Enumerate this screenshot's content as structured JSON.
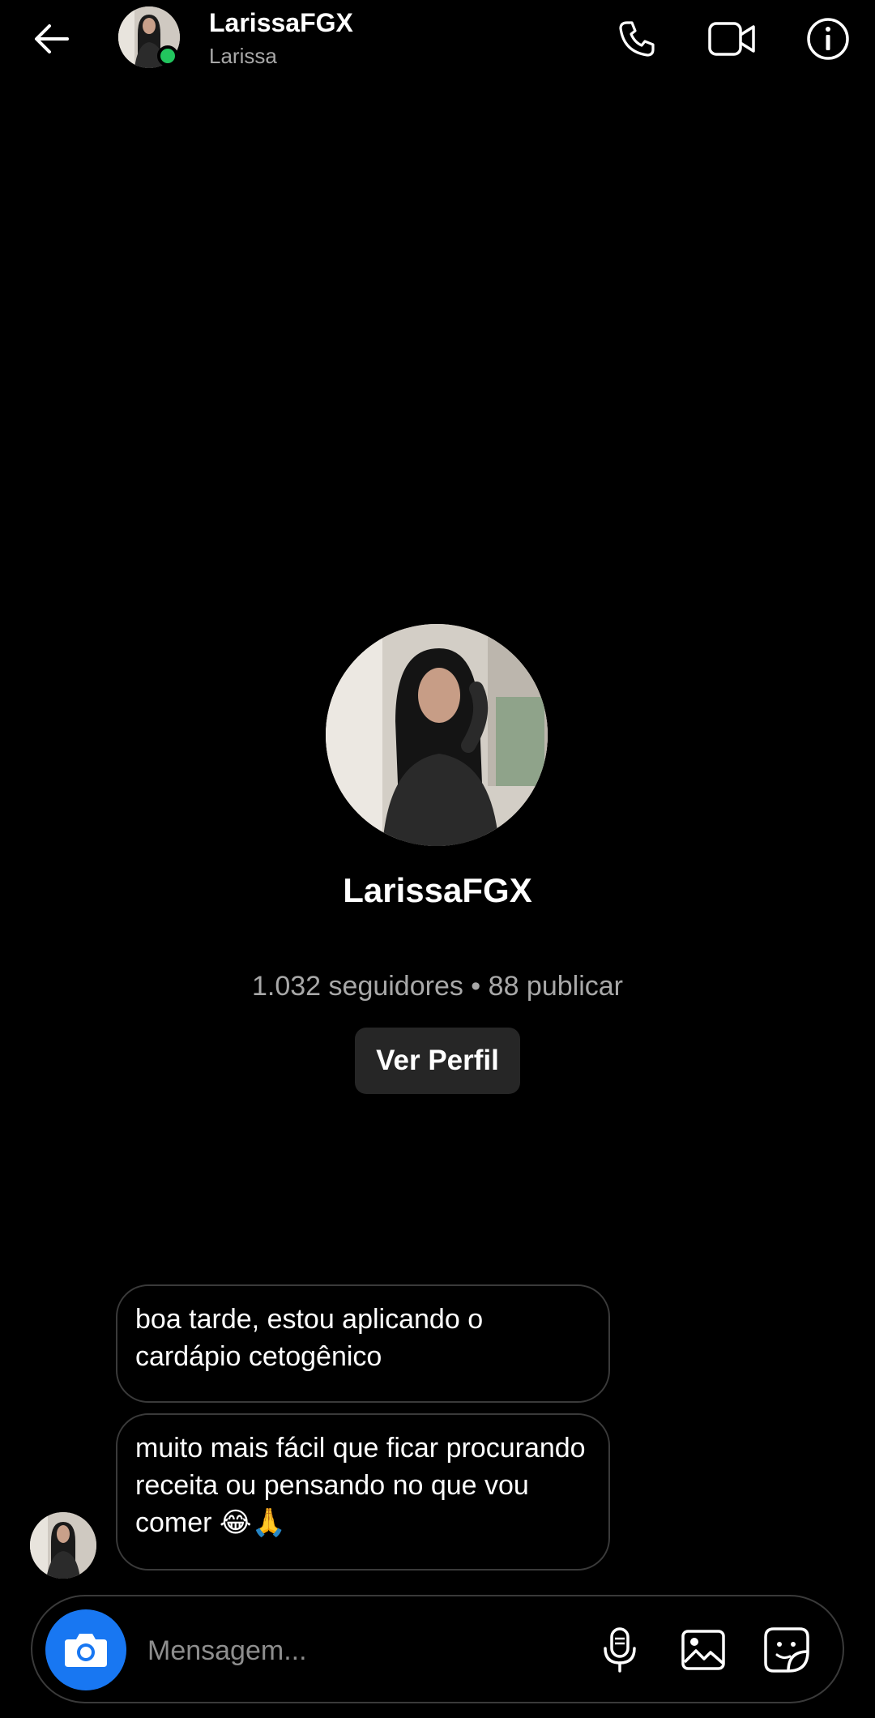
{
  "header": {
    "title": "LarissaFGX",
    "subtitle": "Larissa",
    "icons": [
      "back-arrow-icon",
      "phone-icon",
      "video-camera-icon",
      "info-icon"
    ]
  },
  "profile": {
    "name": "LarissaFGX",
    "stats": "1.032 seguidores • 88 publicar",
    "view_button": "Ver Perfil"
  },
  "messages": [
    {
      "text": "boa tarde, estou aplicando o cardápio cetogênico"
    },
    {
      "text": "muito mais fácil que ficar procurando receita ou pensando no que vou comer 😂🙏"
    }
  ],
  "composer": {
    "placeholder": "Mensagem...",
    "icons": [
      "camera-icon",
      "microphone-icon",
      "gallery-icon",
      "sticker-icon"
    ]
  },
  "colors": {
    "background": "#000000",
    "accent": "#1877f2",
    "online": "#22c55e",
    "muted_text": "#a8a8a8",
    "button_bg": "#262626"
  }
}
